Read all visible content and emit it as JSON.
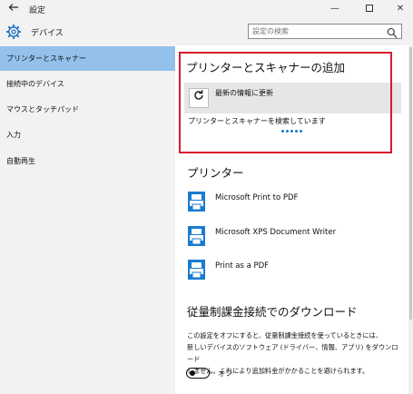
{
  "window": {
    "title": "設定",
    "back_icon": "back-arrow-icon",
    "min_glyph": "—",
    "close_glyph": "✕"
  },
  "header": {
    "app_title": "デバイス",
    "search_placeholder": "設定の検索"
  },
  "sidebar": {
    "items": [
      {
        "label": "プリンターとスキャナー",
        "active": true
      },
      {
        "label": "接続中のデバイス",
        "active": false
      },
      {
        "label": "マウスとタッチパッド",
        "active": false
      },
      {
        "label": "入力",
        "active": false
      },
      {
        "label": "自動再生",
        "active": false
      }
    ]
  },
  "add_section": {
    "title": "プリンターとスキャナーの追加",
    "refresh_label": "最新の情報に更新",
    "status": "プリンターとスキャナーを検索しています"
  },
  "printers": {
    "title": "プリンター",
    "items": [
      {
        "name": "Microsoft Print to PDF"
      },
      {
        "name": "Microsoft XPS Document Writer"
      },
      {
        "name": "Print as a PDF"
      }
    ]
  },
  "metered": {
    "title": "従量制課金接続でのダウンロード",
    "line1": "この設定をオフにすると、従量制課金接続を使っているときには、",
    "line2": "新しいデバイスのソフトウェア (ドライバー、情報、アプリ) をダウンロード",
    "line3": "しません。これにより追加料金がかかることを避けられます。",
    "toggle_label": "オフ",
    "toggle_on": false
  },
  "colors": {
    "accent": "#1a7bd1",
    "active_nav": "#93c1ea",
    "highlight_border": "#d81b2c"
  }
}
